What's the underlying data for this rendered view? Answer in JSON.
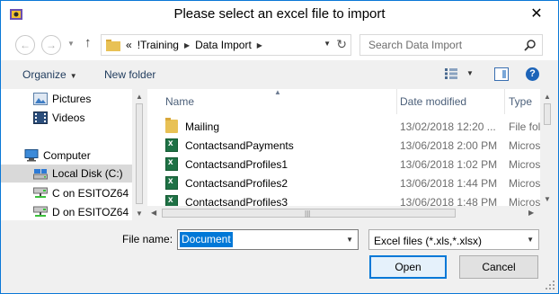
{
  "window": {
    "title": "Please select an excel file to import",
    "close_glyph": "✕"
  },
  "nav_buttons": {
    "back_glyph": "←",
    "forward_glyph": "→",
    "up_glyph": "↑"
  },
  "address": {
    "overflow": "«",
    "crumbs": [
      "!Training",
      "Data Import"
    ],
    "sep_glyph": "▶",
    "dropdown_glyph": "▼",
    "refresh_glyph": "↻"
  },
  "search": {
    "placeholder": "Search Data Import"
  },
  "toolbar": {
    "organize_label": "Organize",
    "new_folder_label": "New folder",
    "caret_glyph": "▼",
    "help_glyph": "?"
  },
  "nav_pane": {
    "items": [
      {
        "label": "Pictures",
        "icon": "pictures-icon"
      },
      {
        "label": "Videos",
        "icon": "videos-icon"
      },
      {
        "label": "Computer",
        "icon": "computer-icon"
      },
      {
        "label": "Local Disk (C:)",
        "icon": "local-disk-icon",
        "selected": true
      },
      {
        "label": "C on ESITOZ64",
        "icon": "network-drive-icon"
      },
      {
        "label": "D on ESITOZ64",
        "icon": "network-drive-icon"
      }
    ]
  },
  "file_list": {
    "columns": {
      "name": "Name",
      "date": "Date modified",
      "type": "Type"
    },
    "rows": [
      {
        "name": "Mailing",
        "date": "13/02/2018 12:20 ...",
        "type": "File fol",
        "kind": "folder"
      },
      {
        "name": "ContactsandPayments",
        "date": "13/06/2018 2:00 PM",
        "type": "Micros",
        "kind": "excel"
      },
      {
        "name": "ContactsandProfiles1",
        "date": "13/06/2018 1:02 PM",
        "type": "Micros",
        "kind": "excel"
      },
      {
        "name": "ContactsandProfiles2",
        "date": "13/06/2018 1:44 PM",
        "type": "Micros",
        "kind": "excel"
      },
      {
        "name": "ContactsandProfiles3",
        "date": "13/06/2018 1:48 PM",
        "type": "Micros",
        "kind": "excel"
      }
    ]
  },
  "bottom": {
    "filename_label": "File name:",
    "filename_value": "Document",
    "filetype_value": "Excel files (*.xls,*.xlsx)",
    "open_label": "Open",
    "cancel_label": "Cancel"
  },
  "colors": {
    "accent": "#0078d7",
    "selected_bg": "#d9d9d9",
    "excel_green": "#1e7145",
    "folder_yellow": "#e8c155"
  }
}
